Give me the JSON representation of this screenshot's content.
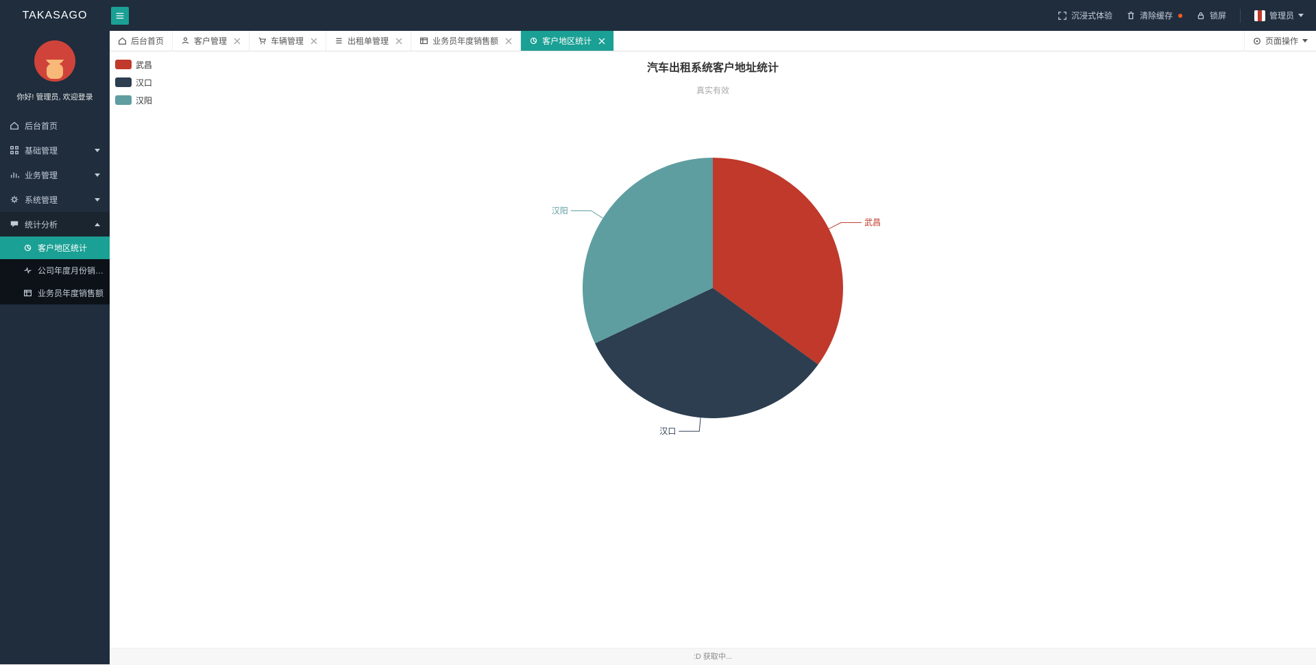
{
  "brand": "TAKASAGO",
  "header": {
    "immersive": "沉浸式体验",
    "clear_cache": "清除缓存",
    "lock_screen": "锁屏",
    "admin": "管理员"
  },
  "sidebar": {
    "welcome": "你好! 管理员, 欢迎登录",
    "items": {
      "home": "后台首页",
      "basic_mgmt": "基础管理",
      "biz_mgmt": "业务管理",
      "sys_mgmt": "系统管理",
      "stats": "统计分析",
      "sub": {
        "cust_region": "客户地区统计",
        "monthly_sales": "公司年度月份销…",
        "sales_rep": "业务员年度销售额"
      }
    }
  },
  "tabs": {
    "home": "后台首页",
    "customer": "客户管理",
    "vehicle": "车辆管理",
    "rental": "出租单管理",
    "sales": "业务员年度销售额",
    "region": "客户地区统计",
    "page_ops": "页面操作"
  },
  "chart_data": {
    "type": "pie",
    "title": "汽车出租系统客户地址统计",
    "subtitle": "真实有效",
    "series": [
      {
        "name": "武昌",
        "value": 35,
        "color": "#c0392b"
      },
      {
        "name": "汉口",
        "value": 33,
        "color": "#2c3e50"
      },
      {
        "name": "汉阳",
        "value": 32,
        "color": "#5f9ea0"
      }
    ],
    "label_positions": {
      "武昌": {
        "x": 480,
        "y": -65
      },
      "汉口": {
        "x": -125,
        "y": 180
      },
      "汉阳": {
        "x": -475,
        "y": -125
      }
    }
  },
  "footer": ":D 获取中..."
}
